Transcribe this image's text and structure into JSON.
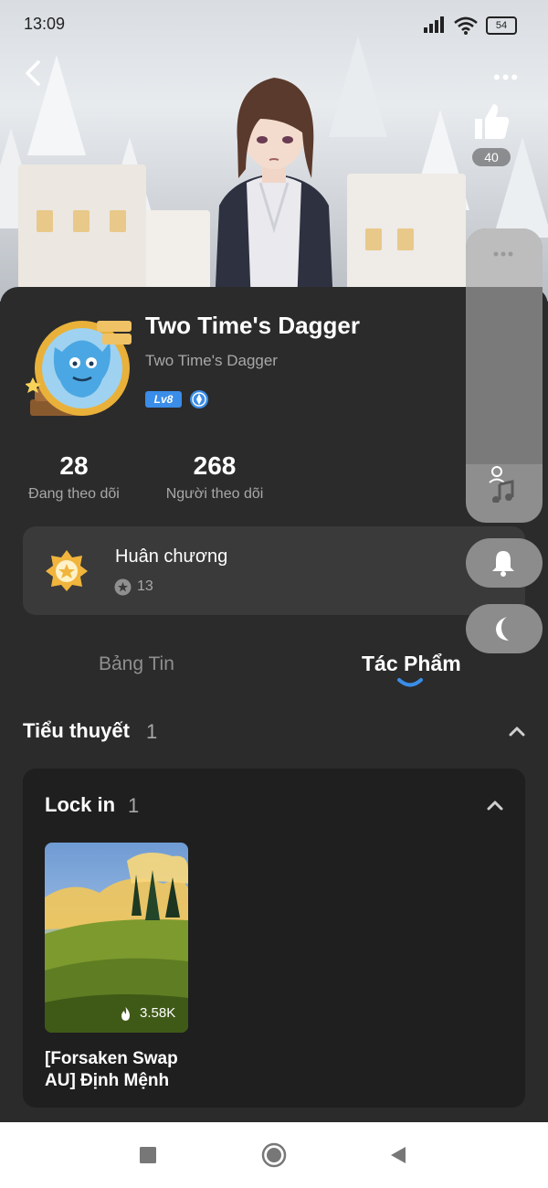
{
  "status_bar": {
    "time": "13:09",
    "battery": "54"
  },
  "header": {
    "like_count": "40"
  },
  "profile": {
    "name": "Two Time's Dagger",
    "handle": "Two Time's Dagger",
    "level_badge": "Lv8",
    "following_count": "28",
    "following_label": "Đang theo dõi",
    "followers_count": "268",
    "followers_label": "Người theo dõi"
  },
  "medal": {
    "title": "Huân chương",
    "count": "13"
  },
  "tabs": [
    {
      "label": "Bảng Tin",
      "active": false
    },
    {
      "label": "Tác Phẩm",
      "active": true
    }
  ],
  "section": {
    "title": "Tiểu thuyết",
    "count": "1"
  },
  "collection": {
    "title": "Lock in",
    "count": "1",
    "items": [
      {
        "title": "[Forsaken Swap AU] Định Mệnh",
        "views": "3.58K"
      }
    ]
  },
  "colors": {
    "background": "#2b2b2b",
    "card": "#3a3a3a",
    "accent_blue": "#3a8de8",
    "muted_text": "#a8a8a8"
  }
}
